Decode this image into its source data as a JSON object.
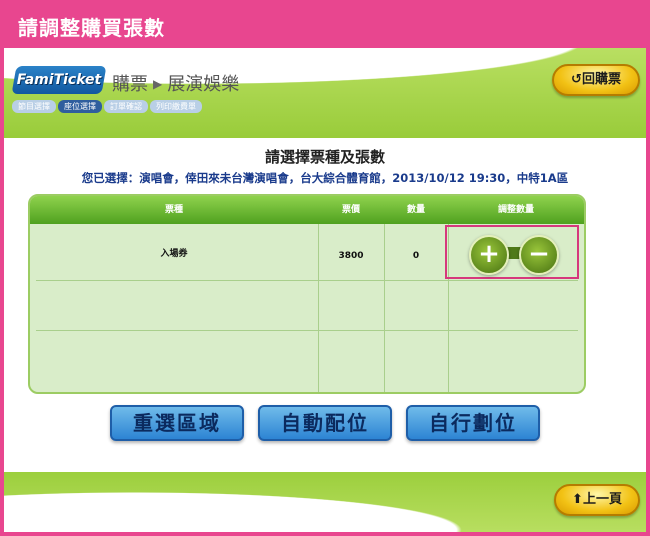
{
  "window": {
    "title": "請調整購買張數"
  },
  "header": {
    "logo_text": "FamiTicket",
    "breadcrumb": [
      "購票",
      "展演娛樂"
    ],
    "steps": [
      {
        "label": "節目選擇",
        "active": false
      },
      {
        "label": "座位選擇",
        "active": true
      },
      {
        "label": "訂單確認",
        "active": false
      },
      {
        "label": "列印繳費單",
        "active": false
      }
    ],
    "back_button": "回購票"
  },
  "main": {
    "heading": "請選擇票種及張數",
    "selection_info": "您已選擇：演唱會，倖田來未台灣演唱會，台大綜合體育館，2013/10/12 19:30，中特1A區",
    "table": {
      "columns": [
        "票種",
        "票價",
        "數量",
        "調整數量"
      ],
      "rows": [
        {
          "ticket_type": "入場券",
          "price": "3800",
          "quantity": "0"
        }
      ]
    },
    "plus_icon": "+",
    "minus_icon": "−"
  },
  "actions": {
    "reselect_area": "重選區域",
    "auto_seat": "自動配位",
    "manual_seat": "自行劃位"
  },
  "footer": {
    "prev_button": "上一頁"
  },
  "colors": {
    "title_bar": "#e8468f",
    "green": "#99cc3a",
    "button_blue": "#2d84d3",
    "highlight": "#d6387c"
  }
}
